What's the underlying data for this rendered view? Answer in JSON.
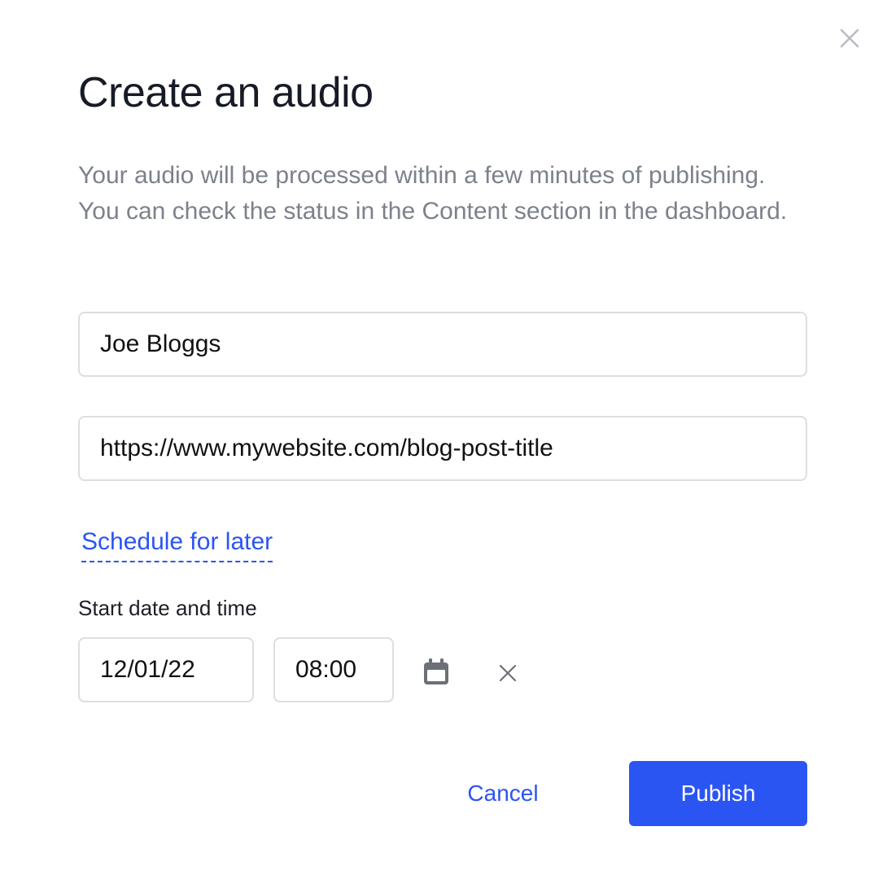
{
  "dialog": {
    "title": "Create an audio",
    "description": "Your audio will be processed within a few minutes of publishing. You can check the status in the Content section in the dashboard.",
    "close_icon": "close-icon"
  },
  "form": {
    "name_value": "Joe Bloggs",
    "url_value": "https://www.mywebsite.com/blog-post-title",
    "schedule_link": "Schedule for later",
    "start_label": "Start date and time",
    "date_value": "12/01/22",
    "time_value": "08:00",
    "calendar_icon": "calendar-icon",
    "clear_icon": "clear-icon"
  },
  "actions": {
    "cancel_label": "Cancel",
    "publish_label": "Publish"
  },
  "colors": {
    "accent": "#2b55f2",
    "title": "#161b26",
    "muted_text": "#7c818b",
    "border": "#dcdee2",
    "icon": "#6b7079"
  }
}
